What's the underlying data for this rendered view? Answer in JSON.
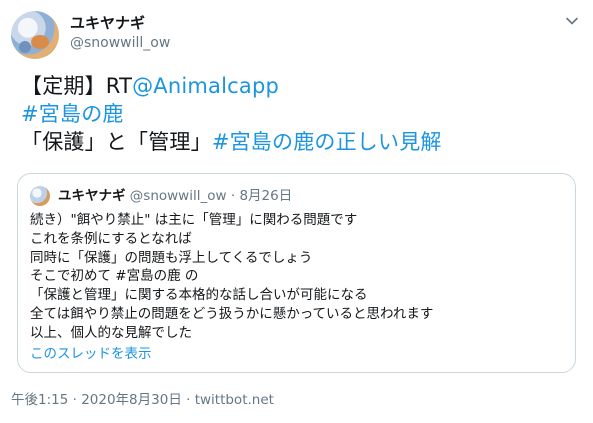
{
  "author": {
    "name": "ユキヤナギ",
    "handle": "@snowwill_ow"
  },
  "tweet": {
    "lines": [
      {
        "prefix": "【定期】RT",
        "mention": "@Animalcapp"
      },
      {
        "hashtag": "#宮島の鹿"
      },
      {
        "prefix": "「保護」と「管理」",
        "hashtag": "#宮島の鹿の正しい見解"
      }
    ]
  },
  "quoted": {
    "name": "ユキヤナギ",
    "handle": "@snowwill_ow",
    "separator": "·",
    "date": "8月26日",
    "lines": [
      "続き）\"餌やり禁止\" は主に「管理」に関わる問題です",
      "これを条例にするとなれば",
      "同時に「保護」の問題も浮上してくるでしょう",
      "そこで初めて #宮島の鹿 の",
      "「保護と管理」に関する本格的な話し合いが可能になる",
      "全ては餌やり禁止の問題をどう扱うかに懸かっていると思われます",
      "以上、個人的な見解でした"
    ],
    "show_thread": "このスレッドを表示"
  },
  "footer": {
    "time": "午後1:15 · 2020年8月30日 · ",
    "source": "twittbot.net"
  },
  "icons": {
    "menu": "chevron-down-icon",
    "avatar": "avatar"
  },
  "colors": {
    "link": "#1b95e0",
    "muted": "#657786",
    "text": "#14171a",
    "border": "#ccd6dd"
  }
}
